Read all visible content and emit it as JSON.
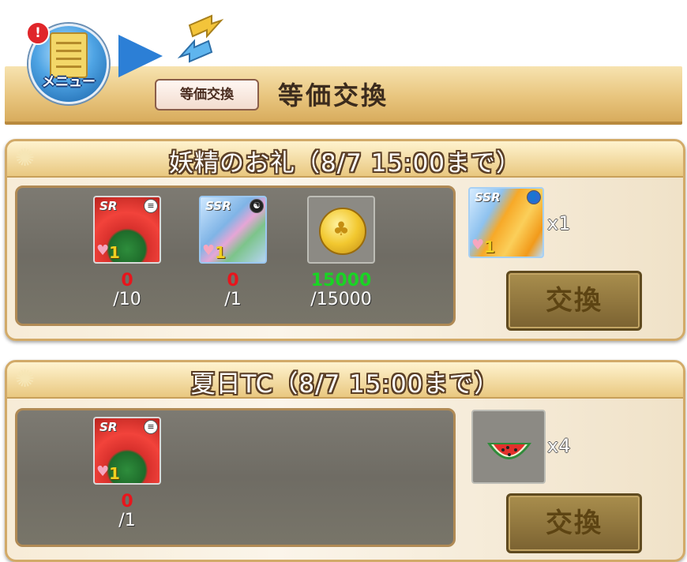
{
  "header": {
    "menu_label": "メニュー",
    "menu_alert": "!",
    "breadcrumb_chip": "等価交換",
    "title": "等価交換"
  },
  "cards": [
    {
      "title": "妖精のお礼（8/7 15:00まで）",
      "requirements": [
        {
          "rarity": "SR",
          "level": "1",
          "icon": "watermelon-card-icon",
          "have": "0",
          "need": "/10",
          "have_color": "#e8151c"
        },
        {
          "rarity": "SSR",
          "level": "1",
          "icon": "tanzaku-card-icon",
          "have": "0",
          "need": "/1",
          "have_color": "#e8151c"
        },
        {
          "icon": "gold-coin-icon",
          "have": "15000",
          "need": "/15000",
          "have_color": "#19d424"
        }
      ],
      "reward": {
        "rarity": "SSR",
        "level": "1",
        "icon": "energy-drink-card-icon",
        "quantity": "x1"
      },
      "button": "交換"
    },
    {
      "title": "夏日TC（8/7 15:00まで）",
      "requirements": [
        {
          "rarity": "SR",
          "level": "1",
          "icon": "watermelon-card-icon",
          "have": "0",
          "need": "/1",
          "have_color": "#e8151c"
        }
      ],
      "reward": {
        "icon": "watermelon-slice-icon",
        "quantity": "x4"
      },
      "button": "交換"
    }
  ]
}
